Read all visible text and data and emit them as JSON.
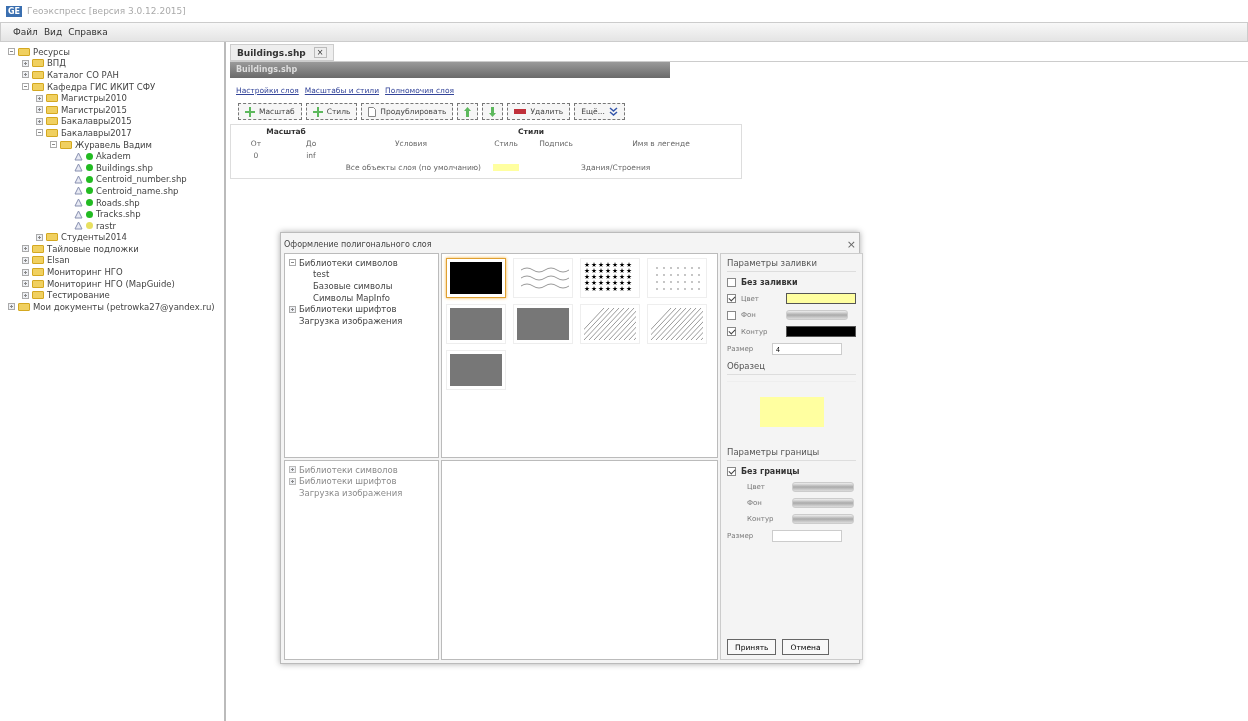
{
  "window": {
    "logo": "GE",
    "title": "Геоэкспресс [версия 3.0.12.2015]"
  },
  "menu": [
    "Файл",
    "Вид",
    "Справка"
  ],
  "tree": [
    {
      "label": "Ресурсы",
      "kind": "folder",
      "expanded": true,
      "children": [
        {
          "label": "ВПД",
          "kind": "folder",
          "expanded": false
        },
        {
          "label": "Каталог СО РАН",
          "kind": "folder",
          "expanded": false
        },
        {
          "label": "Кафедра ГИС ИКИТ СФУ",
          "kind": "folder",
          "expanded": true,
          "children": [
            {
              "label": "Магистры2010",
              "kind": "folder",
              "expanded": false
            },
            {
              "label": "Магистры2015",
              "kind": "folder",
              "expanded": false
            },
            {
              "label": "Бакалавры2015",
              "kind": "folder",
              "expanded": false
            },
            {
              "label": "Бакалавры2017",
              "kind": "folder",
              "expanded": true,
              "children": [
                {
                  "label": "Журавель Вадим",
                  "kind": "folder",
                  "expanded": true,
                  "children": [
                    {
                      "label": "Akadem",
                      "kind": "layer",
                      "color": "#22bb22"
                    },
                    {
                      "label": "Buildings.shp",
                      "kind": "layer",
                      "color": "#22bb22"
                    },
                    {
                      "label": "Centroid_number.shp",
                      "kind": "layer",
                      "color": "#22bb22"
                    },
                    {
                      "label": "Centroid_name.shp",
                      "kind": "layer",
                      "color": "#22bb22"
                    },
                    {
                      "label": "Roads.shp",
                      "kind": "layer",
                      "color": "#22bb22"
                    },
                    {
                      "label": "Tracks.shp",
                      "kind": "layer",
                      "color": "#22bb22"
                    },
                    {
                      "label": "rastr",
                      "kind": "layer",
                      "color": "#e8e060"
                    }
                  ]
                }
              ]
            },
            {
              "label": "Студенты2014",
              "kind": "folder",
              "expanded": false
            }
          ]
        },
        {
          "label": "Тайловые подложки",
          "kind": "folder",
          "expanded": false
        },
        {
          "label": "Elsan",
          "kind": "folder",
          "expanded": false
        },
        {
          "label": "Мониторинг НГО",
          "kind": "folder",
          "expanded": false
        },
        {
          "label": "Мониторинг НГО (MapGuide)",
          "kind": "folder",
          "expanded": false
        },
        {
          "label": "Тестирование",
          "kind": "folder",
          "expanded": false
        }
      ]
    },
    {
      "label": "Мои документы (petrowka27@yandex.ru)",
      "kind": "folder",
      "expanded": false
    }
  ],
  "tab": {
    "label": "Buildings.shp",
    "close": "×"
  },
  "panel_title": "Buildings.shp",
  "links": [
    "Настройки слоя",
    "Масштабы и стили",
    "Полномочия слоя"
  ],
  "toolbar": [
    {
      "label": "Масштаб",
      "kind": "add"
    },
    {
      "label": "Стиль",
      "kind": "add"
    },
    {
      "label": "Продублировать",
      "kind": "copy"
    },
    {
      "kind": "up"
    },
    {
      "kind": "down"
    },
    {
      "label": "Удалить",
      "kind": "delete"
    },
    {
      "label": "Ещё...",
      "kind": "more"
    }
  ],
  "table": {
    "groups": [
      "Масштаб",
      "Стили"
    ],
    "columns": [
      "От",
      "До",
      "Условия",
      "Стиль",
      "Подпись",
      "Имя в легенде"
    ],
    "scale_row": {
      "from": "0",
      "to": "inf"
    },
    "style_row": {
      "condition": "Все объекты слоя (по умолчанию)",
      "color": "#ffffa0",
      "legend": "Здания/Строения"
    }
  },
  "dialog": {
    "title": "Оформление полигонального слоя",
    "close": "×",
    "library_tree": [
      {
        "label": "Библиотеки символов",
        "expanded": true,
        "children": [
          {
            "label": "test"
          },
          {
            "label": "Базовые символы"
          },
          {
            "label": "Символы MapInfo"
          }
        ]
      },
      {
        "label": "Библиотеки шрифтов",
        "expanded": false
      },
      {
        "label": "Загрузка изображения"
      }
    ],
    "library_tree_2": [
      {
        "label": "Библиотеки символов",
        "expanded": false
      },
      {
        "label": "Библиотеки шрифтов",
        "expanded": false
      },
      {
        "label": "Загрузка изображения"
      }
    ],
    "symbols": [
      {
        "kind": "solid",
        "selected": true
      },
      {
        "kind": "waves",
        "selected": false
      },
      {
        "kind": "stars",
        "selected": false
      },
      {
        "kind": "dots",
        "selected": false
      },
      {
        "kind": "gray",
        "selected": false
      },
      {
        "kind": "gray",
        "selected": false
      },
      {
        "kind": "hatch",
        "selected": false
      },
      {
        "kind": "hatch",
        "selected": false
      },
      {
        "kind": "gray",
        "selected": false
      }
    ],
    "fill": {
      "title": "Параметры заливки",
      "none_label": "Без заливки",
      "none": false,
      "rows": [
        {
          "label": "Цвет",
          "checked": true,
          "color": "#ffffa0"
        },
        {
          "label": "Фон",
          "checked": false
        },
        {
          "label": "Контур",
          "checked": true,
          "color": "#000000"
        }
      ],
      "size_label": "Размер",
      "size": "4"
    },
    "sample": {
      "title": "Образец",
      "color": "#ffffa0"
    },
    "border": {
      "title": "Параметры границы",
      "none_label": "Без границы",
      "none": true,
      "rows": [
        {
          "label": "Цвет"
        },
        {
          "label": "Фон"
        },
        {
          "label": "Контур"
        }
      ],
      "size_label": "Размер"
    },
    "buttons": [
      "Принять",
      "Отмена"
    ]
  }
}
